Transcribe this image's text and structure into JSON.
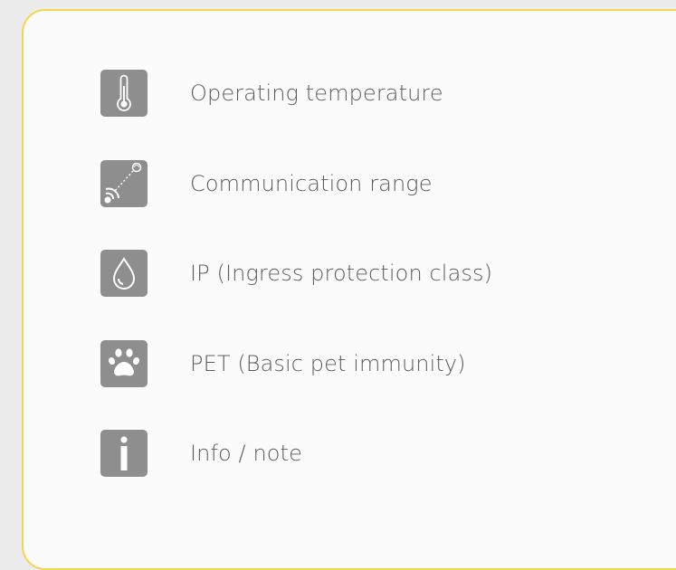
{
  "legend": {
    "items": [
      {
        "icon": "thermometer-icon",
        "label": "Operating temperature"
      },
      {
        "icon": "signal-range-icon",
        "label": "Communication range"
      },
      {
        "icon": "water-drop-icon",
        "label": "IP (Ingress protection class)"
      },
      {
        "icon": "paw-icon",
        "label": "PET (Basic pet immunity)"
      },
      {
        "icon": "info-icon",
        "label": "Info / note"
      }
    ]
  },
  "colors": {
    "border": "#f3d64a",
    "icon_background": "#8e8e8e",
    "text": "#5c5c5c"
  }
}
